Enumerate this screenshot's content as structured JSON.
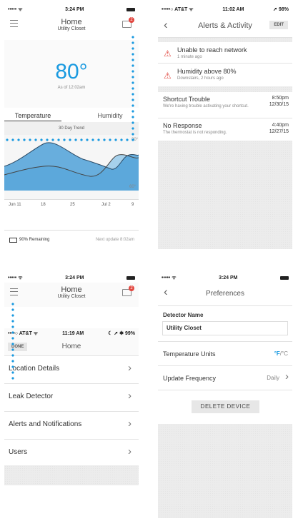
{
  "screen1": {
    "status": {
      "carrier": "•••••  ᯤ",
      "time": "3:24 PM"
    },
    "title": "Home",
    "subtitle": "Utility Closet",
    "badge": "2",
    "temperature": "80°",
    "as_of": "As of 12:02am",
    "tabs": [
      "Temperature",
      "Humidity"
    ],
    "trend_label": "30 Day Trend",
    "scale_high": "80°",
    "scale_low": "60°",
    "x_ticks": [
      "Jun 11",
      "18",
      "25",
      "Jul 2",
      "9"
    ],
    "battery": "90% Remaining",
    "next_update": "Next update 8:02am"
  },
  "screen2": {
    "status": {
      "carrier": "•••••○ AT&T ᯤ",
      "time": "11:02 AM",
      "right": "➚ 98%"
    },
    "title": "Alerts & Activity",
    "edit": "EDIT",
    "alerts": [
      {
        "title": "Unable to reach network",
        "sub": "1 minute ago"
      },
      {
        "title": "Humidity above 80%",
        "sub": "Downstairs, 2 hours ago"
      }
    ],
    "activity": [
      {
        "title": "Shortcut Trouble",
        "sub": "We're having trouble activating your shortcut.",
        "time": "8:50pm",
        "date": "12/30/15"
      },
      {
        "title": "No Response",
        "sub": "The thermostat is not responding.",
        "time": "4:40pm",
        "date": "12/27/15"
      }
    ]
  },
  "screen3": {
    "status": {
      "carrier": "•••••  ᯤ",
      "time": "3:24 PM"
    },
    "title": "Home",
    "subtitle": "Utility Closet",
    "badge": "2",
    "inner_status": {
      "carrier": "••••○ AT&T ᯤ",
      "time": "11:19 AM",
      "right": "☾ ➚ ✱ 99%"
    },
    "done": "DONE",
    "inner_title": "Home",
    "menu": [
      "Location Details",
      "Leak Detector",
      "Alerts and Notifications",
      "Users"
    ]
  },
  "screen4": {
    "status": {
      "carrier": "•••••  ᯤ",
      "time": "3:24 PM"
    },
    "title": "Preferences",
    "detector_label": "Detector Name",
    "detector_value": "Utility Closet",
    "temp_units_label": "Temperature Units",
    "unit_f": "°F",
    "unit_c": "/°C",
    "update_label": "Update Frequency",
    "update_value": "Daily",
    "delete": "DELETE DEVICE"
  },
  "colors": {
    "accent": "#1a9ae0",
    "alert_red": "#e2463e",
    "chart_fill": "#5aa9dd"
  }
}
